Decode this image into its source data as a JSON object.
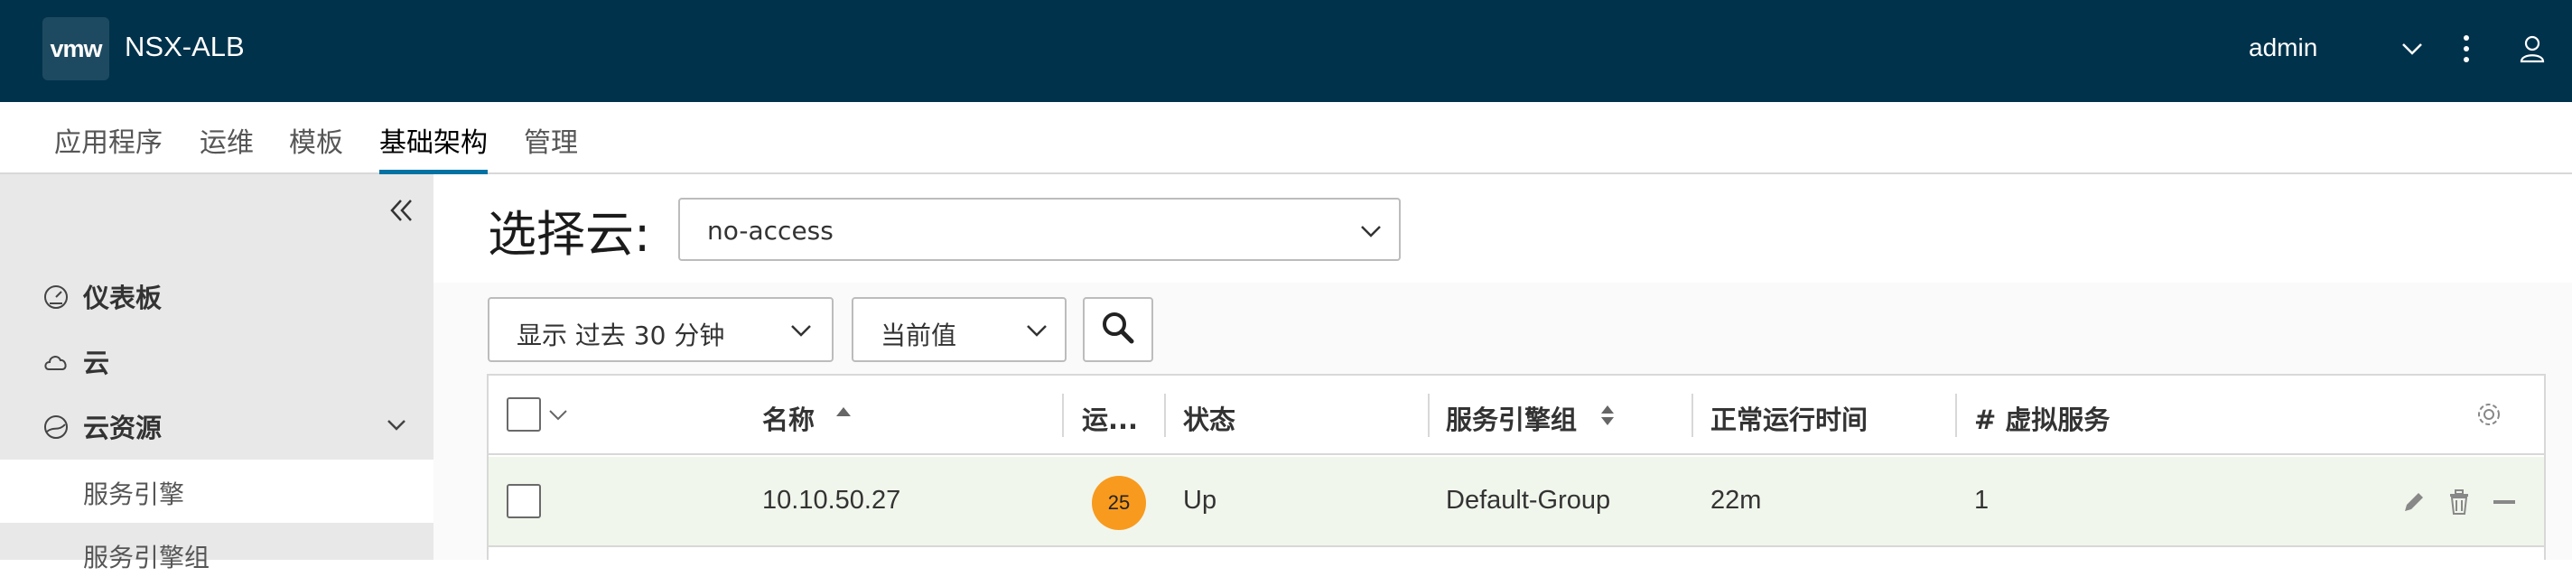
{
  "header": {
    "logo_text": "vmw",
    "app_name": "NSX-ALB",
    "user": "admin"
  },
  "nav": {
    "tabs": [
      {
        "label": "应用程序",
        "active": false
      },
      {
        "label": "运维",
        "active": false
      },
      {
        "label": "模板",
        "active": false
      },
      {
        "label": "基础架构",
        "active": true
      },
      {
        "label": "管理",
        "active": false
      }
    ]
  },
  "sidebar": {
    "items": [
      {
        "label": "仪表板",
        "icon": "dashboard-icon"
      },
      {
        "label": "云",
        "icon": "cloud-icon"
      },
      {
        "label": "云资源",
        "icon": "cloud-resources-icon",
        "expanded": true
      }
    ],
    "subitems": [
      {
        "label": "服务引擎",
        "selected": true
      },
      {
        "label": "服务引擎组",
        "selected": false
      }
    ]
  },
  "cloud_select": {
    "label": "选择云:",
    "value": "no-access"
  },
  "filters": {
    "time_range": "显示 过去 30 分钟",
    "metric": "当前值"
  },
  "table": {
    "columns": {
      "name": "名称",
      "health": "运...",
      "status": "状态",
      "se_group": "服务引擎组",
      "uptime": "正常运行时间",
      "vs_count": "# 虚拟服务"
    },
    "rows": [
      {
        "name": "10.10.50.27",
        "health": "25",
        "status": "Up",
        "se_group": "Default-Group",
        "uptime": "22m",
        "vs_count": "1"
      }
    ]
  },
  "colors": {
    "header_bg": "#00324b",
    "active_tab_underline": "#0072a3",
    "health_badge": "#f89a1e",
    "row_bg": "#f1f6ec"
  }
}
